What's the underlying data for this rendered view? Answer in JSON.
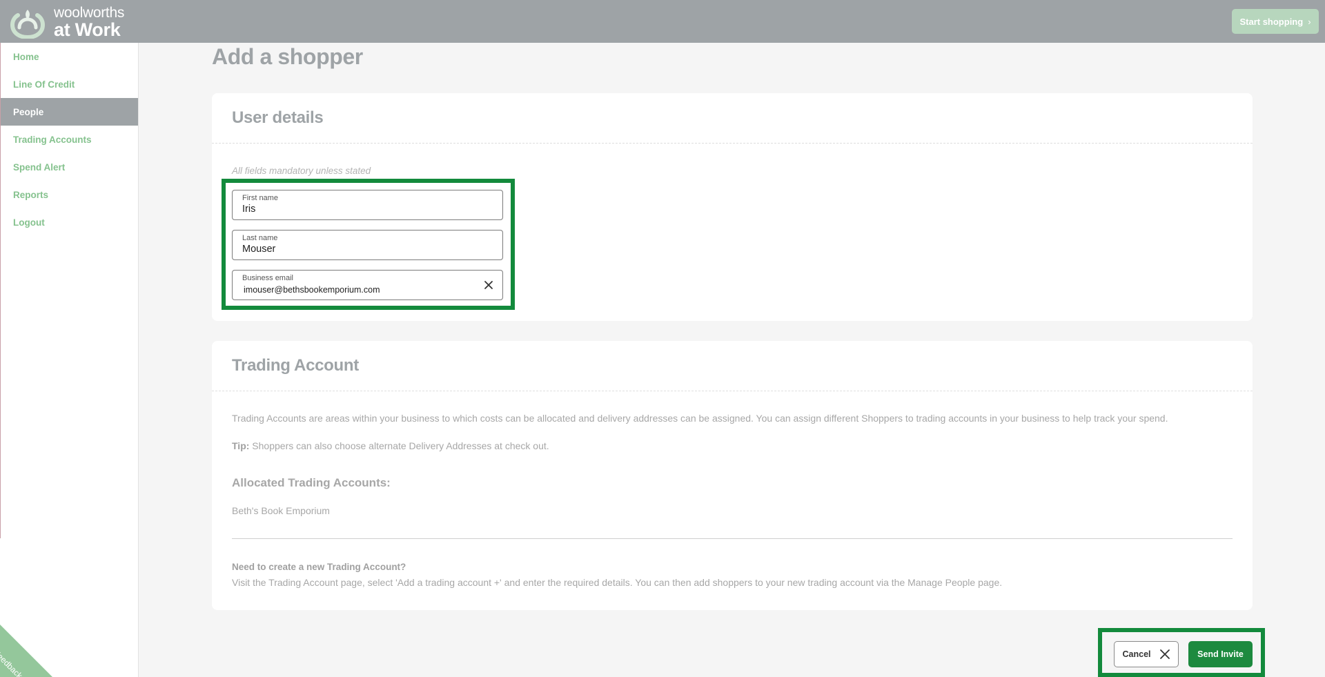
{
  "header": {
    "logo_line1": "woolworths",
    "logo_line2": "at Work",
    "start_shopping_label": "Start shopping",
    "start_shopping_icon": "chevron-right-icon"
  },
  "sidebar": {
    "items": [
      {
        "label": "Home",
        "active": false
      },
      {
        "label": "Line Of Credit",
        "active": false
      },
      {
        "label": "People",
        "active": true
      },
      {
        "label": "Trading Accounts",
        "active": false
      },
      {
        "label": "Spend Alert",
        "active": false
      },
      {
        "label": "Reports",
        "active": false
      },
      {
        "label": "Logout",
        "active": false
      }
    ],
    "feedback_label": "Feedback"
  },
  "page": {
    "title": "Add a shopper"
  },
  "user_details": {
    "title": "User details",
    "hint": "All fields mandatory unless stated",
    "first_name": {
      "label": "First name",
      "value": "Iris"
    },
    "last_name": {
      "label": "Last name",
      "value": "Mouser"
    },
    "business_email": {
      "label": "Business email",
      "value": "imouser@bethsbookemporium.com",
      "clear_icon": "close-icon"
    }
  },
  "trading_account": {
    "title": "Trading Account",
    "description": "Trading Accounts are areas within your business to which costs can be allocated and delivery addresses can be assigned. You can assign different Shoppers to trading accounts in your business to help track your spend.",
    "tip_label": "Tip:",
    "tip_text": " Shoppers can also choose alternate Delivery Addresses at check out.",
    "allocated_title": "Allocated Trading Accounts:",
    "allocated_accounts": [
      "Beth's Book Emporium"
    ],
    "new_account_heading": "Need to create a new Trading Account?",
    "new_account_text": "Visit the Trading Account page, select 'Add a trading account +' and enter the required details. You can then add shoppers to your new trading account via the Manage People page."
  },
  "actions": {
    "cancel_label": "Cancel",
    "cancel_icon": "close-icon",
    "send_label": "Send Invite"
  },
  "colors": {
    "header_bg": "#9ea3a6",
    "brand_green": "#1d8a3f",
    "nav_green": "#85c28e",
    "highlight_green": "#138a3c"
  }
}
